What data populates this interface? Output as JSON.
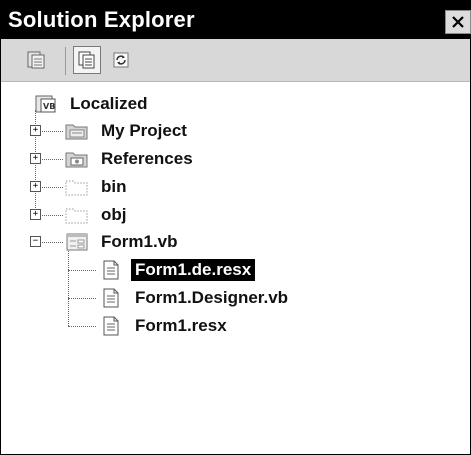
{
  "panel": {
    "title": "Solution Explorer",
    "close_glyph": "✕"
  },
  "toolbar": {
    "buttons": [
      {
        "icon": "properties-icon"
      },
      {
        "icon": "show-all-files-icon",
        "pressed": true
      },
      {
        "icon": "refresh-icon"
      }
    ]
  },
  "tree": {
    "root": {
      "label": "Localized",
      "icon": "vb-project-icon"
    },
    "items": [
      {
        "label": "My Project",
        "icon": "my-project-icon",
        "expander": "+"
      },
      {
        "label": "References",
        "icon": "references-icon",
        "expander": "+"
      },
      {
        "label": "bin",
        "icon": "folder-dashed-icon",
        "expander": "+"
      },
      {
        "label": "obj",
        "icon": "folder-dashed-icon",
        "expander": "+"
      },
      {
        "label": "Form1.vb",
        "icon": "form-icon",
        "expander": "−"
      }
    ],
    "children": [
      {
        "label": "Form1.de.resx",
        "icon": "resx-file-icon",
        "selected": true
      },
      {
        "label": "Form1.Designer.vb",
        "icon": "vb-file-icon"
      },
      {
        "label": "Form1.resx",
        "icon": "resx-file-icon"
      }
    ]
  }
}
